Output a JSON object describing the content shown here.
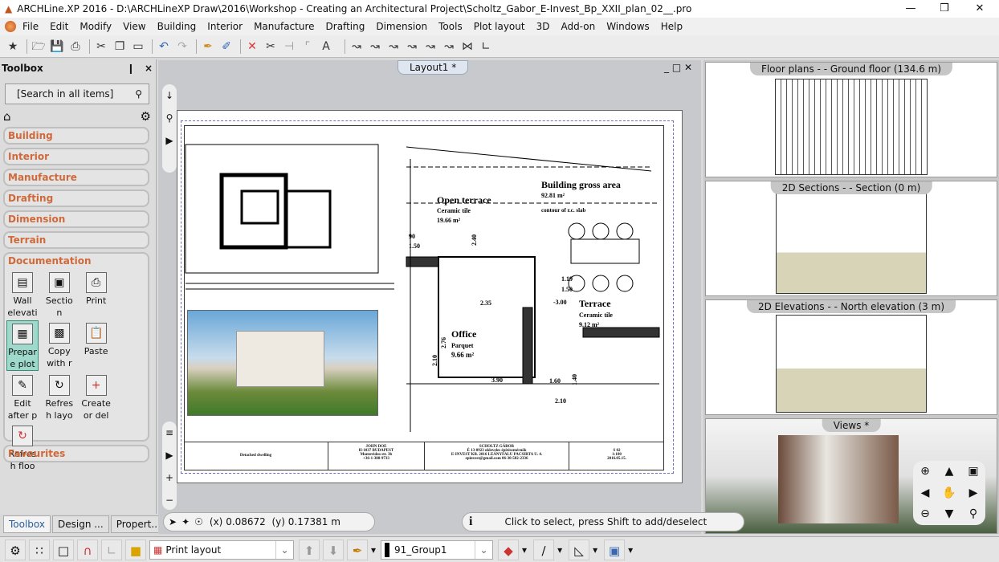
{
  "window": {
    "title": "ARCHLine.XP 2016 - D:\\ARCHLineXP Draw\\2016\\Workshop - Creating an Architectural Project\\Scholtz_Gabor_E-Invest_Bp_XXII_plan_02__.pro",
    "minimize": "—",
    "maximize": "❒",
    "close": "✕"
  },
  "menu": [
    "File",
    "Edit",
    "Modify",
    "View",
    "Building",
    "Interior",
    "Manufacture",
    "Drafting",
    "Dimension",
    "Tools",
    "Plot layout",
    "3D",
    "Add-on",
    "Windows",
    "Help"
  ],
  "toolbox": {
    "title": "Toolbox",
    "pin": "❙",
    "close": "×",
    "search_placeholder": "[Search in all items]",
    "categories": [
      "Building",
      "Interior",
      "Manufacture",
      "Drafting",
      "Dimension",
      "Terrain"
    ],
    "open_category": "Documentation",
    "tools": [
      {
        "label": "Wall elevati",
        "icon": "wall-elevation-icon"
      },
      {
        "label": "Sectio n",
        "icon": "section-icon"
      },
      {
        "label": "Print",
        "icon": "printer-icon"
      },
      {
        "label": "Prepar e plot",
        "icon": "prepare-plot-icon",
        "selected": true
      },
      {
        "label": "Copy with r",
        "icon": "copy-icon"
      },
      {
        "label": "Paste",
        "icon": "paste-icon"
      },
      {
        "label": "Edit after p",
        "icon": "edit-icon"
      },
      {
        "label": "Refres h layo",
        "icon": "refresh-layout-icon"
      },
      {
        "label": "Create or del",
        "icon": "create-delete-icon"
      },
      {
        "label": "Refres h floo",
        "icon": "refresh-floor-icon"
      }
    ],
    "favourites": "Favourites",
    "bottom_tabs": [
      "Toolbox",
      "Design ...",
      "Propert..."
    ]
  },
  "layout": {
    "tab": "Layout1 *",
    "drawing": {
      "open_terrace": "Open terrace",
      "open_terrace_mat": "Ceramic tile",
      "open_terrace_area": "19.66 m²",
      "gross": "Building gross area",
      "gross_area": "92.81 m²",
      "slab": "contour of r.c. slab",
      "office": "Office",
      "office_mat": "Parquet",
      "office_area": "9.66 m²",
      "terrace": "Terrace",
      "terrace_mat": "Ceramic tile",
      "terrace_area": "9.12 m²",
      "level": "-3.00",
      "dims": [
        "90",
        "1.50",
        "2.40",
        "1.50",
        "1.19",
        "1.50",
        "2.35",
        "2.76",
        "2.10",
        "3.90",
        "1.60",
        "2.10",
        "1.40"
      ]
    },
    "titleblock": {
      "project": "Detached dwelling",
      "client": "JOHN DOE\nH-1037 BUDAPEST\nMontevideo str. 3b\n+36-1-388-9733",
      "designer": "SCHOLTZ GÁBOR\nÉ 13-0923  okleveles építészmérnök\nE-INVEST KB. 2016 LEÁNYFALU PACSIRTA U. 4.\nepinvest@gmail.com  06-30-582-2336",
      "sheet": "S 02\n1:100\n2016.05.15."
    }
  },
  "views": [
    {
      "title": "Floor plans -  - Ground floor (134.6 m)"
    },
    {
      "title": "2D Sections -  - Section (0 m)"
    },
    {
      "title": "2D Elevations -  - North elevation (3 m)"
    },
    {
      "title": "Views *"
    }
  ],
  "status": {
    "x_label": "(x)",
    "x": "0.08672",
    "y_label": "(y)",
    "y": "0.17381 m",
    "info": "i",
    "hint": "Click to select, press Shift to add/deselect"
  },
  "bottom": {
    "layer_combo": "Print layout",
    "group_combo": "91_Group1"
  }
}
